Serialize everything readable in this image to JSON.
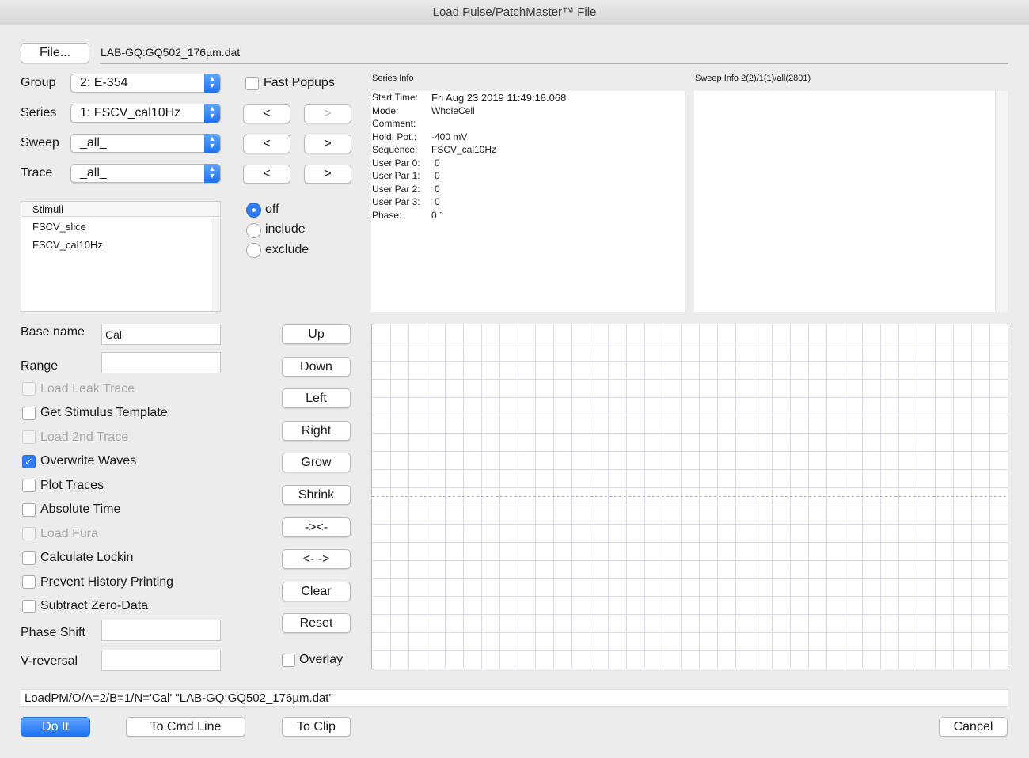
{
  "window": {
    "title": "Load Pulse/PatchMaster™ File"
  },
  "file": {
    "button_label": "File...",
    "path": "LAB-GQ:GQ502_176µm.dat"
  },
  "selectors": {
    "group": {
      "label": "Group",
      "value": "2: E-354"
    },
    "series": {
      "label": "Series",
      "value": "1: FSCV_cal10Hz"
    },
    "sweep": {
      "label": "Sweep",
      "value": "_all_"
    },
    "trace": {
      "label": "Trace",
      "value": "_all_"
    }
  },
  "fast_popups": {
    "label": "Fast Popups",
    "checked": false
  },
  "nav": {
    "prev": "<",
    "next": ">"
  },
  "stimuli": {
    "header": "Stimuli",
    "items": [
      "FSCV_slice",
      "FSCV_cal10Hz"
    ]
  },
  "filter_radio": {
    "options": [
      "off",
      "include",
      "exclude"
    ],
    "selected": "off"
  },
  "series_info": {
    "header": "Series Info",
    "rows": [
      {
        "key": "Start Time:",
        "value": "Fri Aug 23 2019 11:49:18.068"
      },
      {
        "key": "Mode:",
        "value": "WholeCell"
      },
      {
        "key": "Comment:",
        "value": ""
      },
      {
        "key": "Hold. Pot.:",
        "value": "-400 mV"
      },
      {
        "key": "Sequence:",
        "value": "FSCV_cal10Hz"
      },
      {
        "key": "User Par 0:",
        "value": "0"
      },
      {
        "key": "User Par 1:",
        "value": "0"
      },
      {
        "key": "User Par 2:",
        "value": "0"
      },
      {
        "key": "User Par 3:",
        "value": "0"
      },
      {
        "key": "Phase:",
        "value": "0 °"
      }
    ]
  },
  "sweep_info": {
    "header": "Sweep Info 2(2)/1(1)/all(2801)"
  },
  "base_name": {
    "label": "Base name",
    "value": "Cal"
  },
  "range": {
    "label": "Range",
    "value": ""
  },
  "options": [
    {
      "label": "Load Leak Trace",
      "checked": false,
      "disabled": true
    },
    {
      "label": "Get Stimulus Template",
      "checked": false,
      "disabled": false
    },
    {
      "label": "Load 2nd Trace",
      "checked": false,
      "disabled": true
    },
    {
      "label": "Overwrite Waves",
      "checked": true,
      "disabled": false
    },
    {
      "label": "Plot Traces",
      "checked": false,
      "disabled": false
    },
    {
      "label": "Absolute Time",
      "checked": false,
      "disabled": false
    },
    {
      "label": "Load Fura",
      "checked": false,
      "disabled": true
    },
    {
      "label": "Calculate Lockin",
      "checked": false,
      "disabled": false
    },
    {
      "label": "Prevent History Printing",
      "checked": false,
      "disabled": false
    },
    {
      "label": "Subtract Zero-Data",
      "checked": false,
      "disabled": false
    }
  ],
  "phase_shift": {
    "label": "Phase Shift",
    "value": ""
  },
  "v_reversal": {
    "label": "V-reversal",
    "value": ""
  },
  "graph_buttons": [
    "Up",
    "Down",
    "Left",
    "Right",
    "Grow",
    "Shrink",
    "-><-",
    "<- ->",
    "Clear",
    "Reset"
  ],
  "overlay": {
    "label": "Overlay",
    "checked": false
  },
  "colors": {
    "accent": "#1d72f0",
    "trace": "#e58ad0",
    "grid": "#d9d9e6"
  },
  "command_line": "LoadPM/O/A=2/B=1/N='Cal' \"LAB-GQ:GQ502_176µm.dat\"",
  "footer": {
    "do_it": "Do It",
    "to_cmd_line": "To Cmd Line",
    "to_clip": "To Clip",
    "cancel": "Cancel"
  }
}
